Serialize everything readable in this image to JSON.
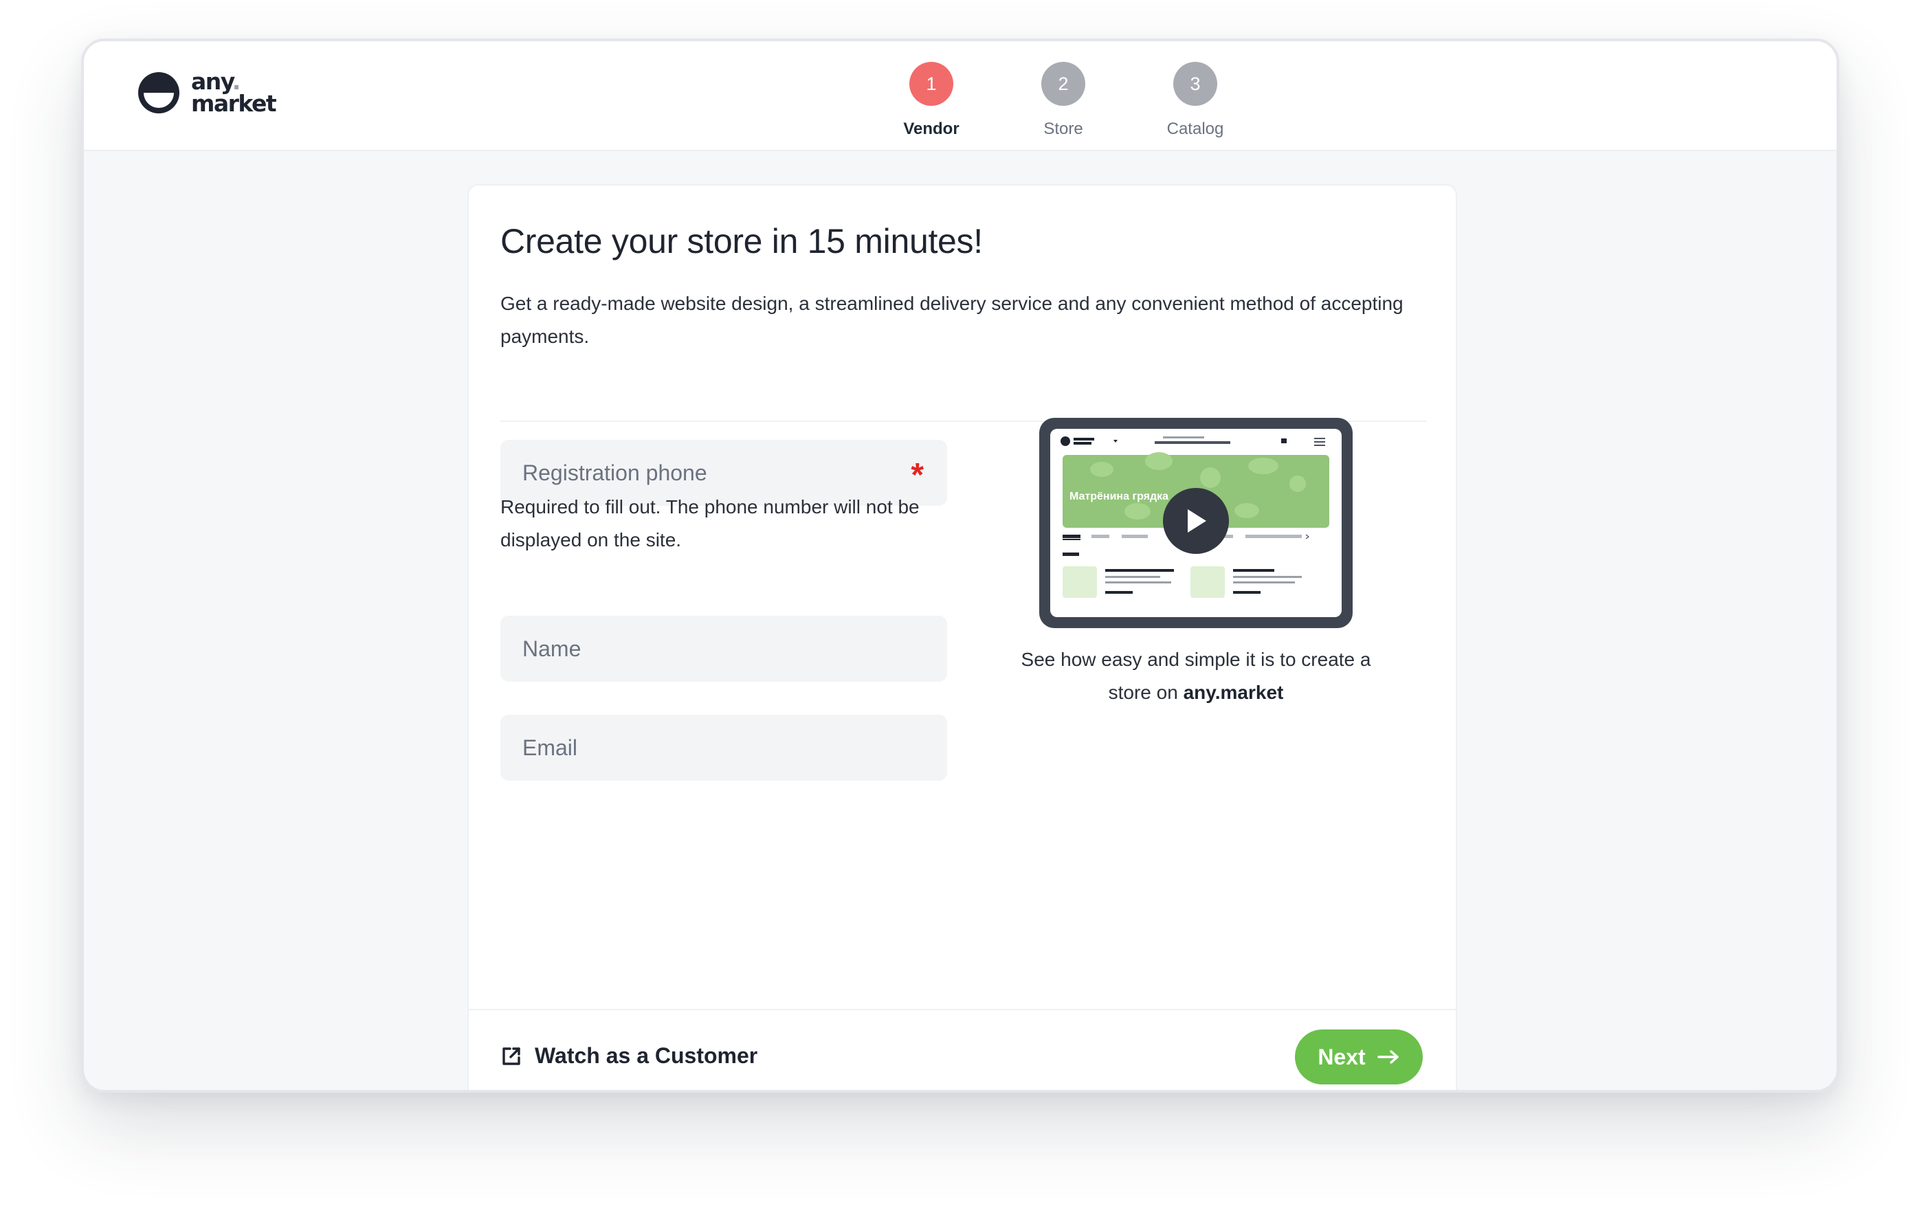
{
  "brand": {
    "name_top": "any",
    "name_bottom": "market"
  },
  "steps": [
    {
      "number": "1",
      "label": "Vendor",
      "state": "active"
    },
    {
      "number": "2",
      "label": "Store",
      "state": "upcoming"
    },
    {
      "number": "3",
      "label": "Catalog",
      "state": "upcoming"
    }
  ],
  "main": {
    "title": "Create your store in 15 minutes!",
    "intro": "Get a ready-made website design, a streamlined delivery service and any convenient method of accepting payments."
  },
  "form": {
    "phone": {
      "placeholder": "Registration phone",
      "value": "",
      "required_mark": "*"
    },
    "phone_hint": "Required to fill out. The phone number will not be displayed on the site.",
    "name": {
      "placeholder": "Name",
      "value": ""
    },
    "email": {
      "placeholder": "Email",
      "value": ""
    }
  },
  "video": {
    "preview_store_title": "Матрёнина грядка",
    "caption_prefix": "See how easy and simple it is to create a store on",
    "caption_brand": "any.market"
  },
  "footer": {
    "watch_label": "Watch as a Customer",
    "next_label": "Next"
  },
  "colors": {
    "accent_green": "#6ac04b",
    "step_active": "#f26b6b",
    "step_idle": "#a8abb1",
    "required": "#e52521"
  }
}
